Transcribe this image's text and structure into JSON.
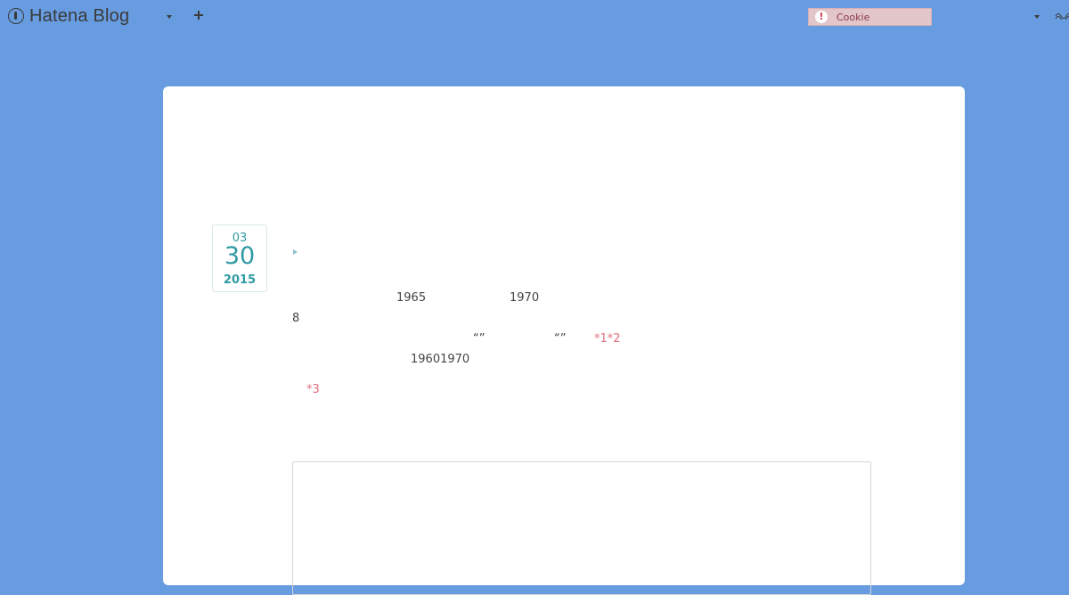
{
  "header": {
    "logo_text": "Hatena Blog",
    "cookie_notice": "Cookie",
    "icons": [
      "hatena-logo-icon",
      "chevron-down-icon",
      "plus-icon",
      "warning-icon",
      "chevron-down-icon",
      "wave-icon"
    ]
  },
  "entry": {
    "date": {
      "month": "03",
      "day": "30",
      "year": "2015"
    },
    "body": {
      "year_a": "1965",
      "year_b": "1970",
      "number": "8",
      "quote_a": "“”",
      "quote_b": "“”",
      "footnote_1_2": "*1*2",
      "years_range": "19601970",
      "footnote_3": "*3"
    }
  },
  "colors": {
    "background": "#689ce0",
    "card": "#ffffff",
    "date_accent": "#2f9aa4",
    "footnote": "#e06f7e",
    "cookie_bg": "#e2c6ca"
  }
}
